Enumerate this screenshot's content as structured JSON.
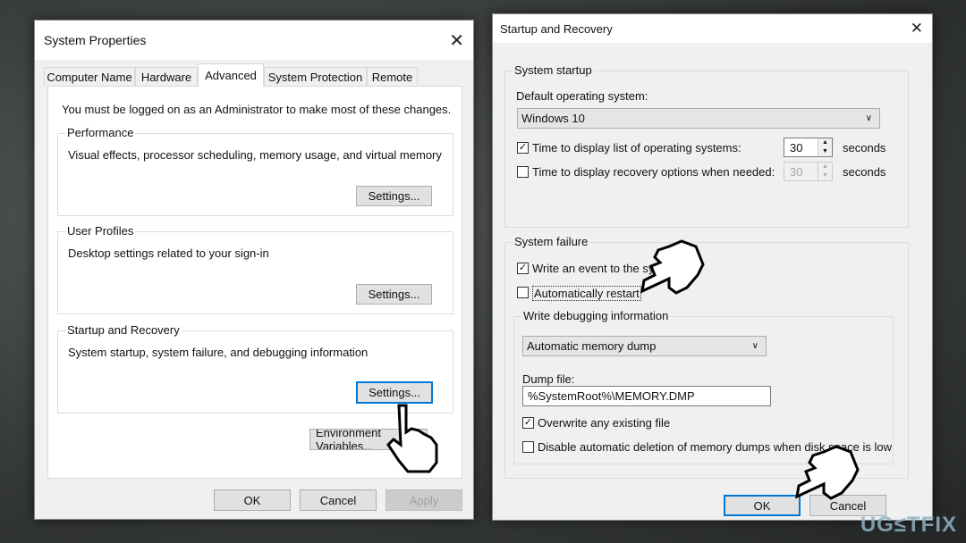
{
  "system_properties": {
    "title": "System Properties",
    "tabs": [
      "Computer Name",
      "Hardware",
      "Advanced",
      "System Protection",
      "Remote"
    ],
    "active_tab": "Advanced",
    "admin_note": "You must be logged on as an Administrator to make most of these changes.",
    "performance": {
      "label": "Performance",
      "desc": "Visual effects, processor scheduling, memory usage, and virtual memory",
      "button": "Settings..."
    },
    "user_profiles": {
      "label": "User Profiles",
      "desc": "Desktop settings related to your sign-in",
      "button": "Settings..."
    },
    "startup_recovery": {
      "label": "Startup and Recovery",
      "desc": "System startup, system failure, and debugging information",
      "button": "Settings..."
    },
    "env_button": "Environment Variables...",
    "ok": "OK",
    "cancel": "Cancel",
    "apply": "Apply"
  },
  "startup_recovery": {
    "title": "Startup and Recovery",
    "system_startup": {
      "label": "System startup",
      "default_os_label": "Default operating system:",
      "default_os_value": "Windows 10",
      "time_list": {
        "label": "Time to display list of operating systems:",
        "checked": true,
        "value": "30",
        "unit": "seconds"
      },
      "time_recovery": {
        "label": "Time to display recovery options when needed:",
        "checked": false,
        "value": "30",
        "unit": "seconds"
      }
    },
    "system_failure": {
      "label": "System failure",
      "write_event": {
        "label": "Write an event to the system log",
        "checked": true
      },
      "auto_restart": {
        "label": "Automatically restart",
        "checked": false
      },
      "debug_label": "Write debugging information",
      "debug_value": "Automatic memory dump",
      "dump_file_label": "Dump file:",
      "dump_file_value": "%SystemRoot%\\MEMORY.DMP",
      "overwrite": {
        "label": "Overwrite any existing file",
        "checked": true
      },
      "disable_deletion": {
        "label": "Disable automatic deletion of memory dumps when disk space is low",
        "checked": false
      }
    },
    "ok": "OK",
    "cancel": "Cancel"
  },
  "watermark": "UG≤TFIX",
  "colors": {
    "focus": "#0078d7"
  }
}
